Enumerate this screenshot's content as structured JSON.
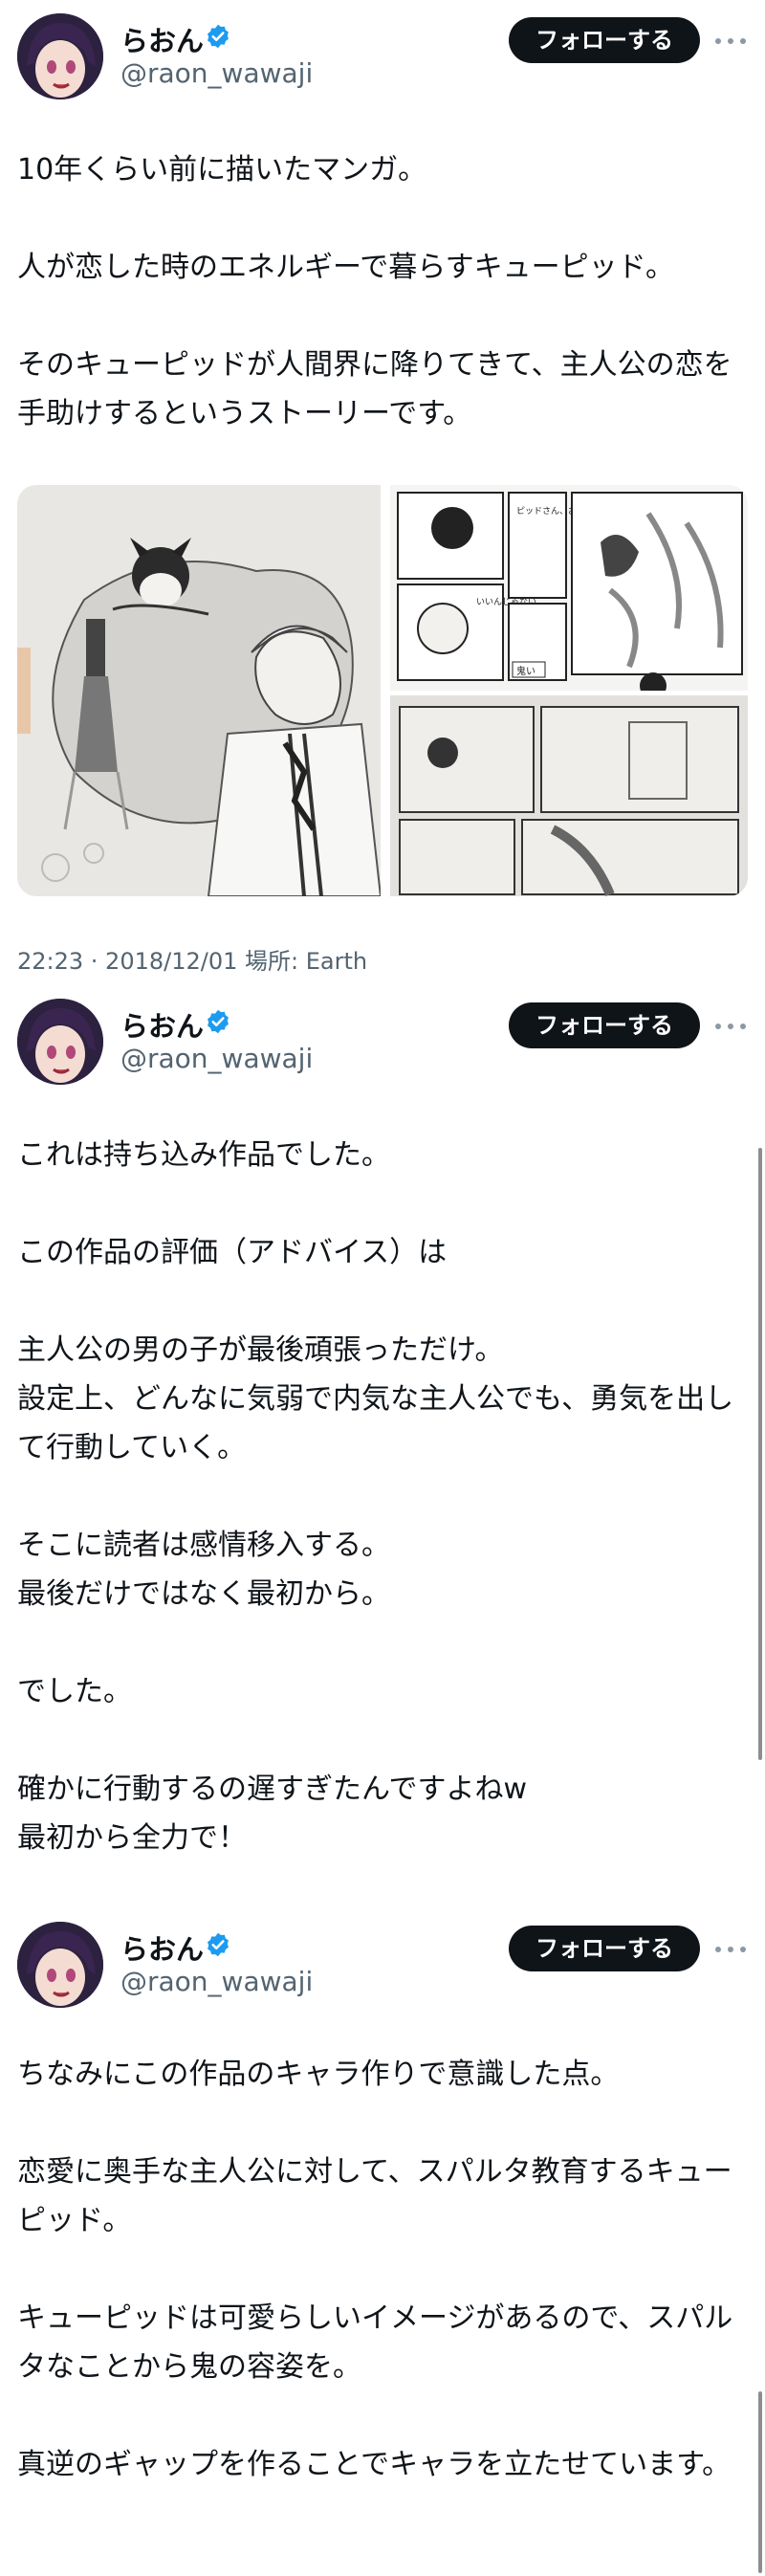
{
  "tweets": [
    {
      "name": "らおん",
      "handle": "@raon_wawaji",
      "follow_label": "フォローする",
      "text": "10年くらい前に描いたマンガ。\n\n人が恋した時のエネルギーで暮らすキューピッド。\n\nそのキューピッドが人間界に降りてきて、主人公の恋を手助けするというストーリーです。",
      "meta": "22:23 · 2018/12/01 場所: Earth",
      "media_text": {
        "bubble_1": "ピッドさん、お願い",
        "bubble_2": "いいんじゃない",
        "box_label": "鬼い"
      }
    },
    {
      "name": "らおん",
      "handle": "@raon_wawaji",
      "follow_label": "フォローする",
      "text": "これは持ち込み作品でした。\n\nこの作品の評価（アドバイス）は\n\n主人公の男の子が最後頑張っただけ。\n設定上、どんなに気弱で内気な主人公でも、勇気を出して行動していく。\n\nそこに読者は感情移入する。\n最後だけではなく最初から。\n\nでした。\n\n確かに行動するの遅すぎたんですよねw\n最初から全力で！"
    },
    {
      "name": "らおん",
      "handle": "@raon_wawaji",
      "follow_label": "フォローする",
      "text": "ちなみにこの作品のキャラ作りで意識した点。\n\n恋愛に奥手な主人公に対して、スパルタ教育するキューピッド。\n\nキューピッドは可愛らしいイメージがあるので、スパルタなことから鬼の容姿を。\n\n真逆のギャップを作ることでキャラを立たせています。"
    }
  ],
  "colors": {
    "text": "#0f1419",
    "muted": "#536471",
    "verified": "#1d9bf0",
    "follow_bg": "#0f1419"
  },
  "icons": {
    "verified": "verified-badge-icon",
    "more": "more-horizontal-icon"
  }
}
